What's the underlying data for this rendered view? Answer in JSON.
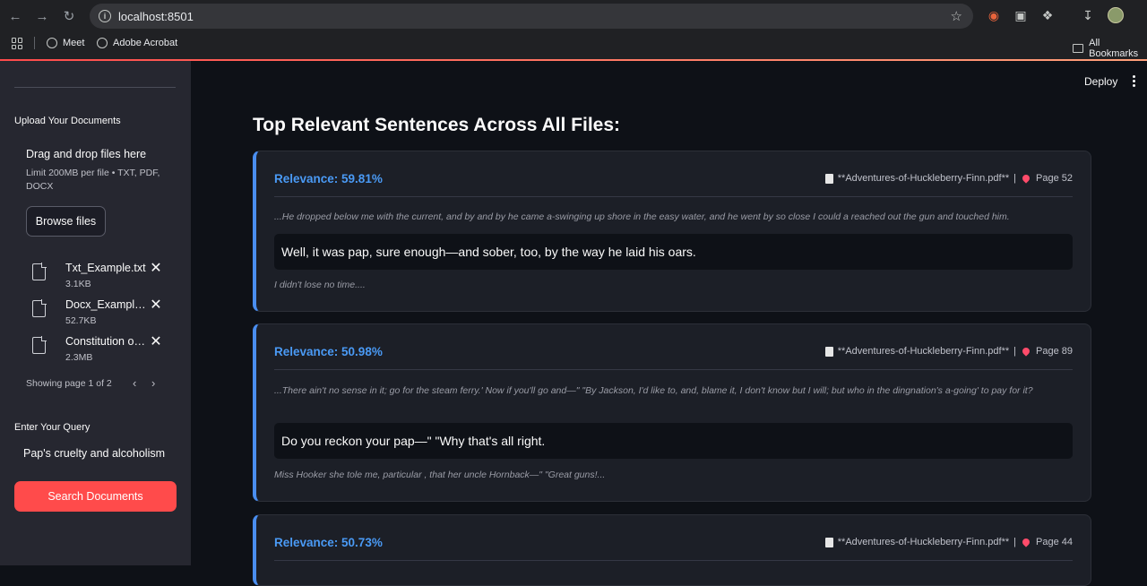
{
  "browser": {
    "url": "localhost:8501",
    "bookmarks": [
      {
        "label": "Meet"
      },
      {
        "label": "Adobe Acrobat"
      }
    ],
    "all_bookmarks": "All Bookmarks"
  },
  "sidebar": {
    "upload_label": "Upload Your Documents",
    "dropzone_title": "Drag and drop files here",
    "dropzone_limit": "Limit 200MB per file • TXT, PDF, DOCX",
    "browse_label": "Browse files",
    "files": [
      {
        "name": "Txt_Example.txt",
        "size": "3.1KB"
      },
      {
        "name": "Docx_Example.docx",
        "size": "52.7KB"
      },
      {
        "name": "Constitution of India.pdf",
        "size": "2.3MB"
      }
    ],
    "pager_text": "Showing page 1 of 2",
    "query_label": "Enter Your Query",
    "query_value": "Pap's cruelty and alcoholism",
    "search_label": "Search Documents"
  },
  "header": {
    "deploy_label": "Deploy"
  },
  "main": {
    "title": "Top Relevant Sentences Across All Files:",
    "results": [
      {
        "relevance": "Relevance: 59.81%",
        "file": "**Adventures-of-Huckleberry-Finn.pdf**",
        "page": "Page 52",
        "before": "...He dropped below me with the current, and by and by he came a-swinging up shore in the easy water, and he went by so close I could a reached out the gun and touched him.",
        "sentence": "Well, it was pap, sure enough—and sober, too, by the way he laid his oars.",
        "after": "I didn't lose no time...."
      },
      {
        "relevance": "Relevance: 50.98%",
        "file": "**Adventures-of-Huckleberry-Finn.pdf**",
        "page": "Page 89",
        "before": "...There ain't no sense in it; go for the steam ferry.' Now if you'll go and—\" \"By Jackson, I'd like to, and, blame it, I don't know but I will; but who in the dingnation's a-going' to pay for it?",
        "sentence": "Do you reckon your pap—\" \"Why that's all right.",
        "after": "Miss Hooker she tole me, particular , that her uncle Hornback—\" \"Great guns!..."
      },
      {
        "relevance": "Relevance: 50.73%",
        "file": "**Adventures-of-Huckleberry-Finn.pdf**",
        "page": "Page 44"
      }
    ]
  }
}
